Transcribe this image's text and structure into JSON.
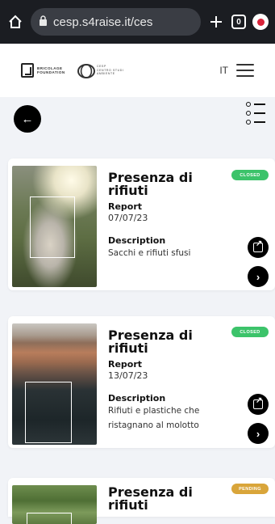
{
  "browser": {
    "url": "cesp.s4raise.it/ces",
    "tab_count": "0",
    "home_icon": "home-icon",
    "lock_icon": "lock-icon",
    "new_tab_icon": "plus-icon"
  },
  "header": {
    "logo1_line1": "BRICOLAGE",
    "logo1_line2": "FOUNDATION",
    "logo2_line1": "CESP",
    "logo2_line2": "CENTRO STUDI",
    "logo2_line3": "AMBIENTE",
    "language": "IT"
  },
  "cards": [
    {
      "title": "Presenza di rifiuti",
      "type": "Report",
      "date": "07/07/23",
      "description_label": "Description",
      "description": "Sacchi e rifiuti sfusi",
      "status": "CLOSED",
      "status_color": "#3cc36a"
    },
    {
      "title": "Presenza di rifiuti",
      "type": "Report",
      "date": "13/07/23",
      "description_label": "Description",
      "description": "Rifiuti e plastiche che ristagnano al molotto",
      "status": "CLOSED",
      "status_color": "#3cc36a"
    },
    {
      "title": "Presenza di rifiuti",
      "status": "PENDING",
      "status_color": "#d9a53a"
    }
  ]
}
